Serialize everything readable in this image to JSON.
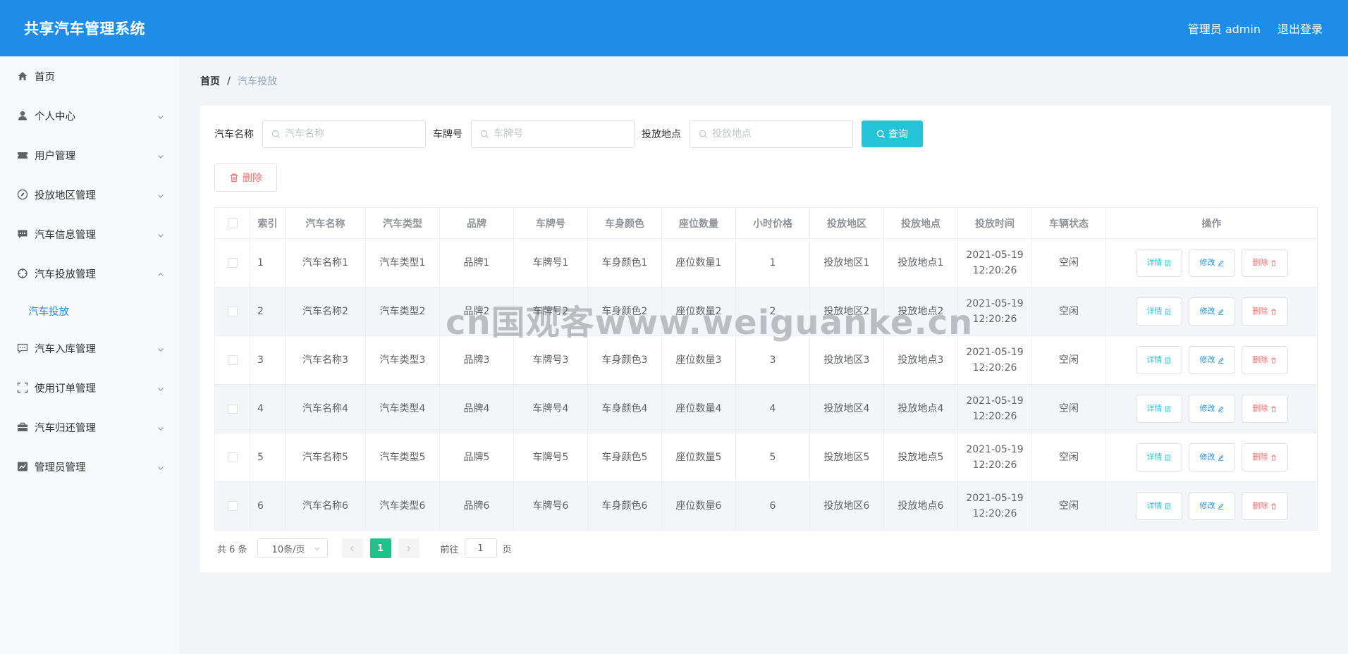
{
  "header": {
    "app_title": "共享汽车管理系统",
    "user_label": "管理员 admin",
    "logout_label": "退出登录"
  },
  "sidebar": {
    "items": [
      {
        "label": "首页",
        "icon": "home-icon"
      },
      {
        "label": "个人中心",
        "icon": "user-icon"
      },
      {
        "label": "用户管理",
        "icon": "ticket-icon"
      },
      {
        "label": "投放地区管理",
        "icon": "compass-icon"
      },
      {
        "label": "汽车信息管理",
        "icon": "chat-icon"
      },
      {
        "label": "汽车投放管理",
        "icon": "target-icon"
      },
      {
        "label": "汽车入库管理",
        "icon": "message-icon"
      },
      {
        "label": "使用订单管理",
        "icon": "fullscreen-icon"
      },
      {
        "label": "汽车归还管理",
        "icon": "briefcase-icon"
      },
      {
        "label": "管理员管理",
        "icon": "chart-icon"
      }
    ],
    "active_sub": "汽车投放"
  },
  "breadcrumb": {
    "home": "首页",
    "separator": "/",
    "current": "汽车投放"
  },
  "search": {
    "car_name_label": "汽车名称",
    "car_name_placeholder": "汽车名称",
    "plate_label": "车牌号",
    "plate_placeholder": "车牌号",
    "location_label": "投放地点",
    "location_placeholder": "投放地点",
    "button_label": "查询"
  },
  "toolbar": {
    "delete_label": "删除"
  },
  "table": {
    "headers": [
      "索引",
      "汽车名称",
      "汽车类型",
      "品牌",
      "车牌号",
      "车身颜色",
      "座位数量",
      "小时价格",
      "投放地区",
      "投放地点",
      "投放时间",
      "车辆状态",
      "操作"
    ],
    "rows": [
      {
        "index": "1",
        "name": "汽车名称1",
        "type": "汽车类型1",
        "brand": "品牌1",
        "plate": "车牌号1",
        "color": "车身颜色1",
        "seats": "座位数量1",
        "price": "1",
        "region": "投放地区1",
        "location": "投放地点1",
        "date": "2021-05-19",
        "time": "12:20:26",
        "status": "空闲"
      },
      {
        "index": "2",
        "name": "汽车名称2",
        "type": "汽车类型2",
        "brand": "品牌2",
        "plate": "车牌号2",
        "color": "车身颜色2",
        "seats": "座位数量2",
        "price": "2",
        "region": "投放地区2",
        "location": "投放地点2",
        "date": "2021-05-19",
        "time": "12:20:26",
        "status": "空闲"
      },
      {
        "index": "3",
        "name": "汽车名称3",
        "type": "汽车类型3",
        "brand": "品牌3",
        "plate": "车牌号3",
        "color": "车身颜色3",
        "seats": "座位数量3",
        "price": "3",
        "region": "投放地区3",
        "location": "投放地点3",
        "date": "2021-05-19",
        "time": "12:20:26",
        "status": "空闲"
      },
      {
        "index": "4",
        "name": "汽车名称4",
        "type": "汽车类型4",
        "brand": "品牌4",
        "plate": "车牌号4",
        "color": "车身颜色4",
        "seats": "座位数量4",
        "price": "4",
        "region": "投放地区4",
        "location": "投放地点4",
        "date": "2021-05-19",
        "time": "12:20:26",
        "status": "空闲"
      },
      {
        "index": "5",
        "name": "汽车名称5",
        "type": "汽车类型5",
        "brand": "品牌5",
        "plate": "车牌号5",
        "color": "车身颜色5",
        "seats": "座位数量5",
        "price": "5",
        "region": "投放地区5",
        "location": "投放地点5",
        "date": "2021-05-19",
        "time": "12:20:26",
        "status": "空闲"
      },
      {
        "index": "6",
        "name": "汽车名称6",
        "type": "汽车类型6",
        "brand": "品牌6",
        "plate": "车牌号6",
        "color": "车身颜色6",
        "seats": "座位数量6",
        "price": "6",
        "region": "投放地区6",
        "location": "投放地点6",
        "date": "2021-05-19",
        "time": "12:20:26",
        "status": "空闲"
      }
    ],
    "ops": {
      "detail": "详情",
      "edit": "修改",
      "delete": "删除"
    }
  },
  "pagination": {
    "total": "共 6 条",
    "page_size": "10条/页",
    "current_page": "1",
    "goto_prefix": "前往",
    "goto_value": "1",
    "goto_suffix": "页"
  },
  "watermark": "cn国观客www.weiguanke.cn",
  "colors": {
    "header_bg": "#1f8ce8",
    "accent": "#1f8ce8",
    "search_button": "#25c3d8",
    "danger": "#f56c6c",
    "page_active": "#1ec38a"
  }
}
